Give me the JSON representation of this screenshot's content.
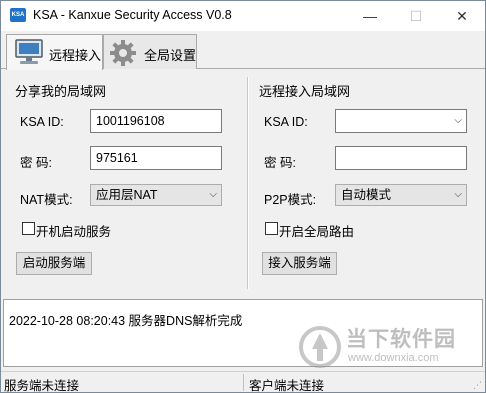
{
  "window": {
    "app_icon_text": "KSA",
    "title": "KSA - Kanxue Security Access V0.8",
    "minimize_glyph": "—",
    "maximize_glyph": "☐",
    "close_glyph": "✕"
  },
  "tabs": [
    {
      "label": "远程接入",
      "icon": "monitor-icon",
      "active": true
    },
    {
      "label": "全局设置",
      "icon": "gear-icon",
      "active": false
    }
  ],
  "share": {
    "title": "分享我的局域网",
    "id_label": "KSA ID:",
    "id_value": "1001196108",
    "pwd_label": "密  码:",
    "pwd_value": "975161",
    "nat_label": "NAT模式:",
    "nat_value": "应用层NAT",
    "autostart_label": "开机启动服务",
    "start_button": "启动服务端"
  },
  "remote": {
    "title": "远程接入局域网",
    "id_label": "KSA ID:",
    "id_value": "",
    "pwd_label": "密  码:",
    "pwd_value": "",
    "p2p_label": "P2P模式:",
    "p2p_value": "自动模式",
    "global_route_label": "开启全局路由",
    "connect_button": "接入服务端"
  },
  "log": {
    "lines": [
      "2022-10-28 08:20:43 服务器DNS解析完成"
    ]
  },
  "status": {
    "server": "服务端未连接",
    "client": "客户端未连接"
  },
  "watermark": {
    "title": "当下软件园",
    "url": "www.downxia.com"
  },
  "colors": {
    "accent": "#1e73c8",
    "window_bg": "#f0f0f0"
  }
}
